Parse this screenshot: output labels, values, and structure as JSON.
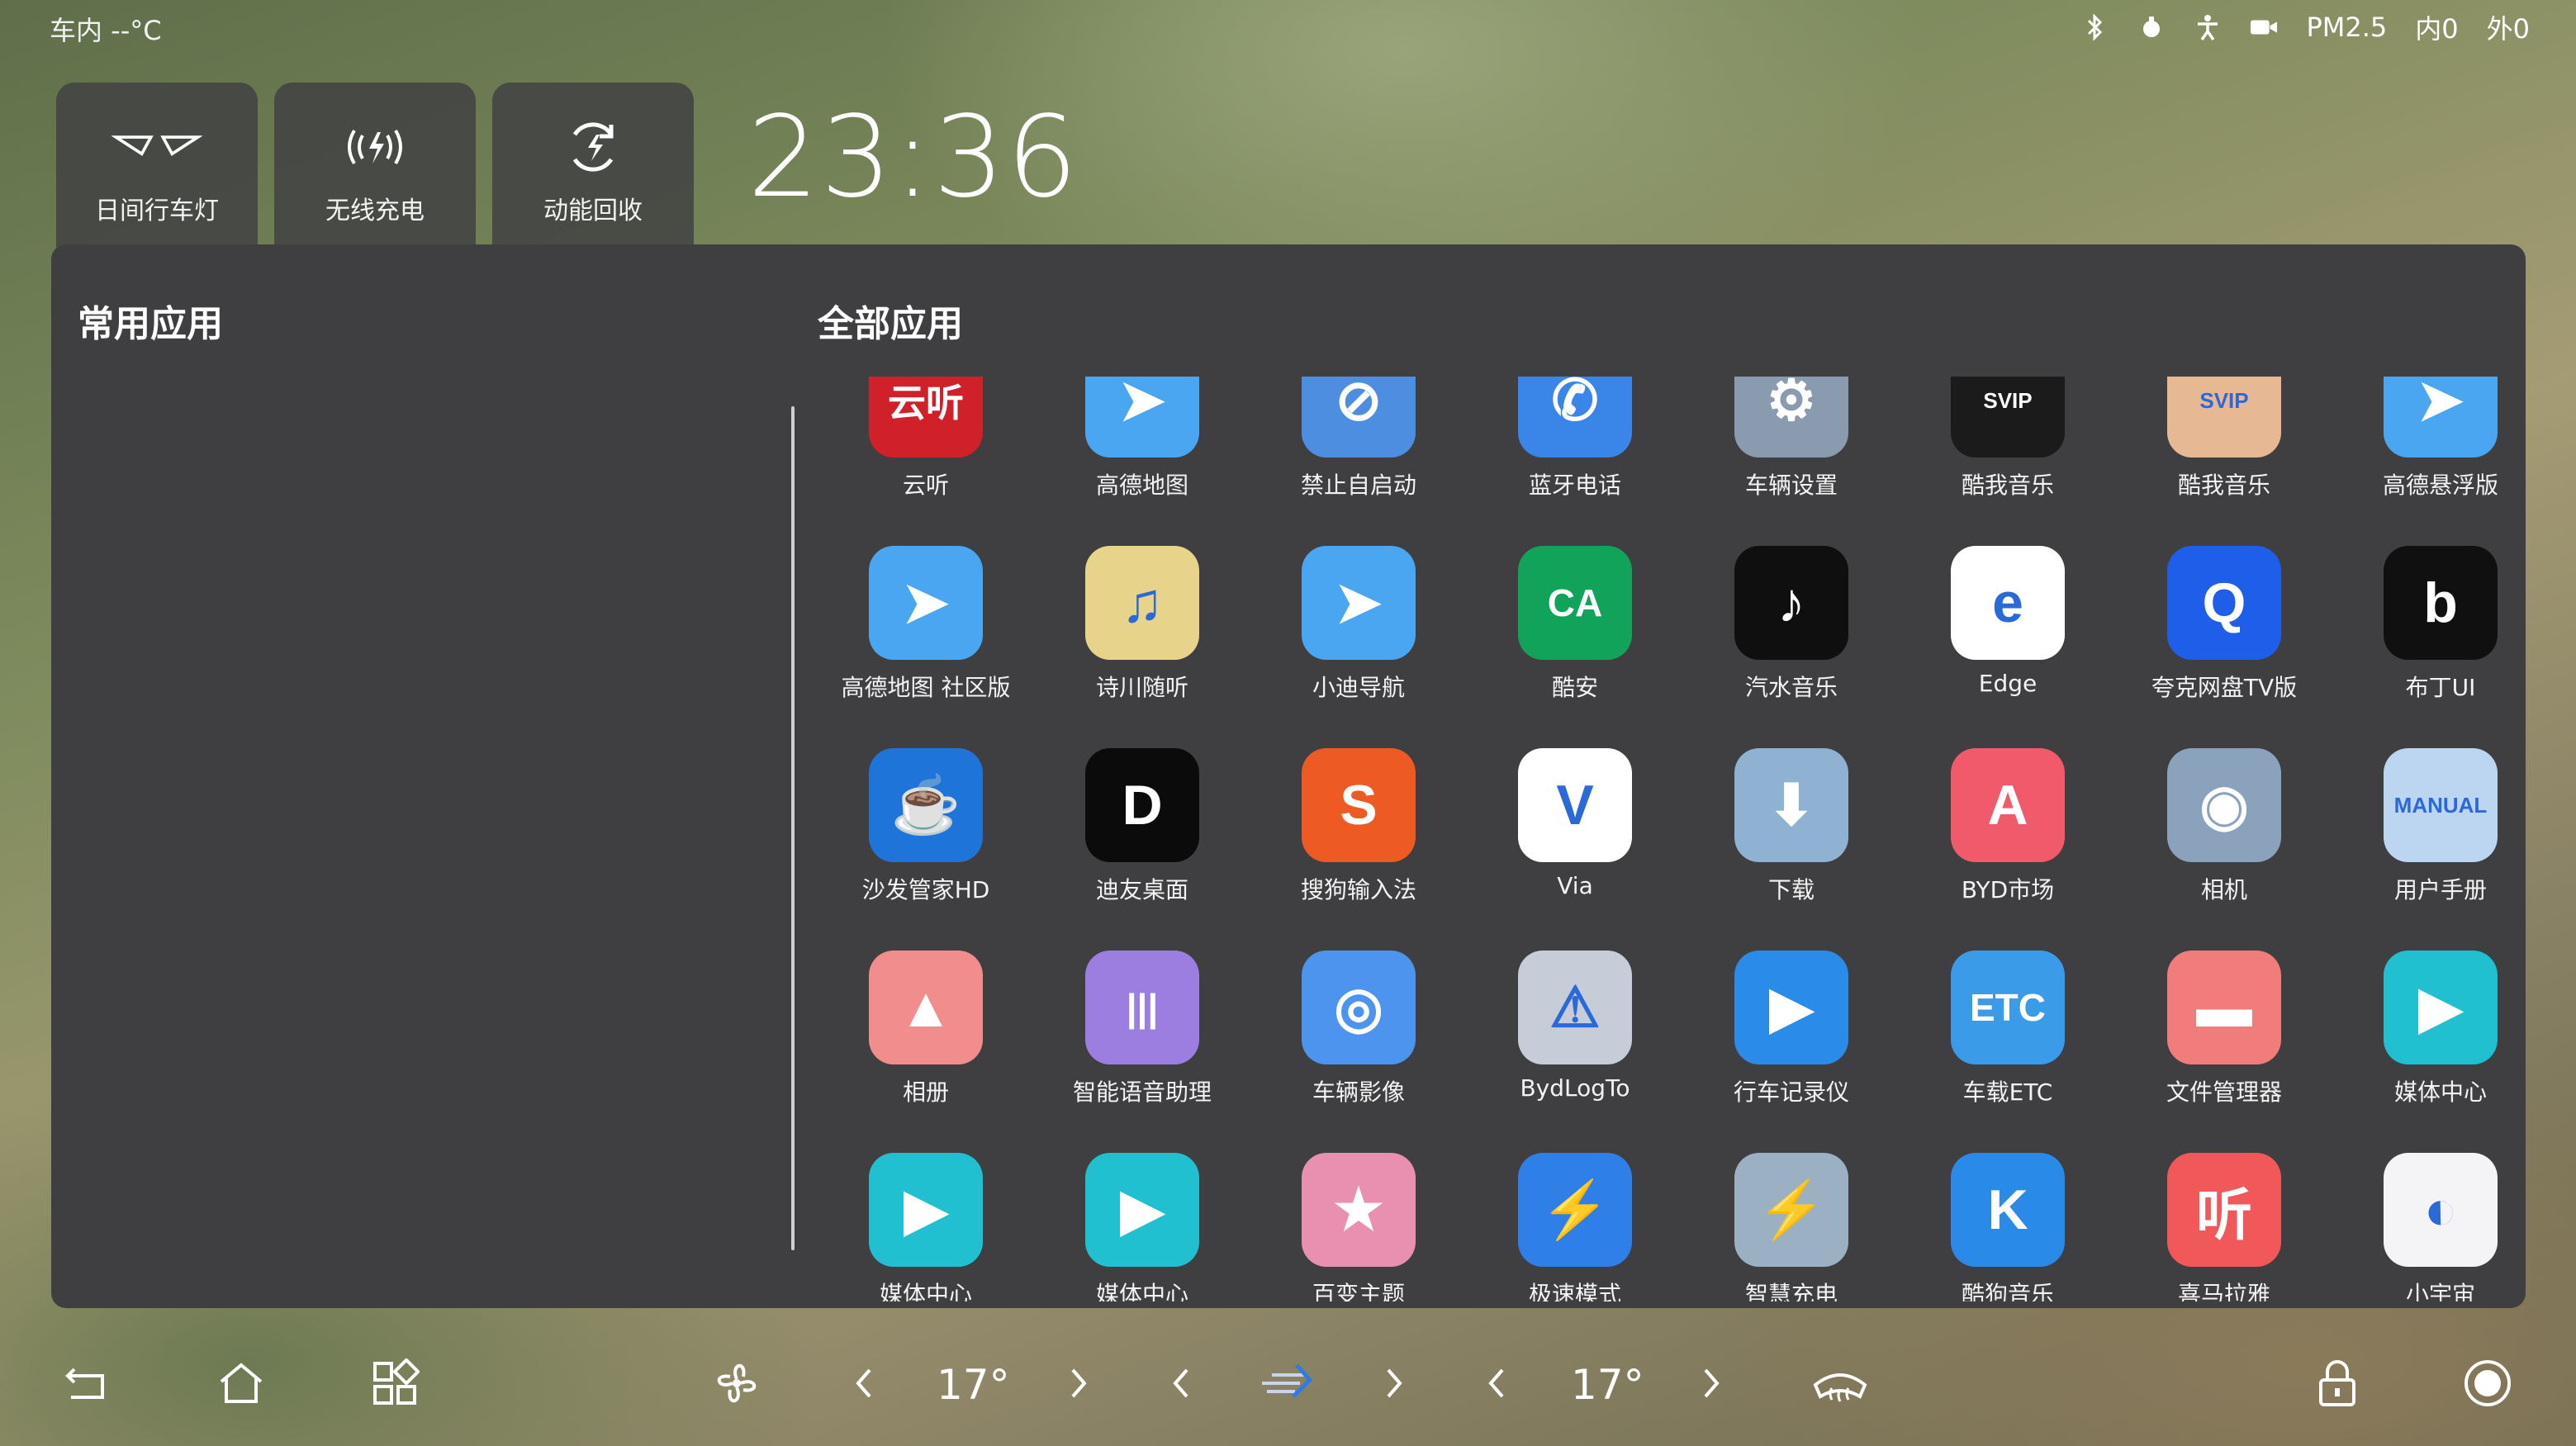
{
  "status": {
    "inside_temp": "车内 --°C",
    "pm25": "PM2.5",
    "pm_in": "内0",
    "pm_out": "外0",
    "icons": [
      "bluetooth-icon",
      "sentry-icon",
      "person-icon",
      "camera-icon"
    ]
  },
  "quick_tiles": [
    {
      "label": "日间行车灯",
      "icon": "daytime-light-icon"
    },
    {
      "label": "无线充电",
      "icon": "wireless-charge-icon"
    },
    {
      "label": "动能回收",
      "icon": "energy-recovery-icon"
    }
  ],
  "clock": "23:36",
  "sections": {
    "frequent": "常用应用",
    "all": "全部应用"
  },
  "apps": [
    {
      "label": "云听",
      "color": "#d0202a",
      "glyph": "云听"
    },
    {
      "label": "高德地图",
      "color": "#4aa6f0",
      "glyph": "➤"
    },
    {
      "label": "禁止自启动",
      "color": "#4d8ee0",
      "glyph": "⊘"
    },
    {
      "label": "蓝牙电话",
      "color": "#3a86e8",
      "glyph": "✆"
    },
    {
      "label": "车辆设置",
      "color": "#8a9bb0",
      "glyph": "⚙"
    },
    {
      "label": "酷我音乐",
      "color": "#1b1b1b",
      "glyph": "SVIP"
    },
    {
      "label": "酷我音乐",
      "color": "#e6b894",
      "glyph": "SVIP"
    },
    {
      "label": "高德悬浮版",
      "color": "#4aa6f0",
      "glyph": "➤"
    },
    {
      "label": "高德地图 社区版",
      "color": "#4aa6f0",
      "glyph": "➤"
    },
    {
      "label": "诗川随听",
      "color": "#e8d38a",
      "glyph": "♫"
    },
    {
      "label": "小迪导航",
      "color": "#4aa6f0",
      "glyph": "➤"
    },
    {
      "label": "酷安",
      "color": "#11a35a",
      "glyph": "CA"
    },
    {
      "label": "汽水音乐",
      "color": "#0f0f0f",
      "glyph": "♪"
    },
    {
      "label": "Edge",
      "color": "#ffffff",
      "glyph": "e"
    },
    {
      "label": "夸克网盘TV版",
      "color": "#1f5ee8",
      "glyph": "Q"
    },
    {
      "label": "布丁UI",
      "color": "#101010",
      "glyph": "b"
    },
    {
      "label": "沙发管家HD",
      "color": "#1e74d8",
      "glyph": "☕"
    },
    {
      "label": "迪友桌面",
      "color": "#0b0b0b",
      "glyph": "D"
    },
    {
      "label": "搜狗输入法",
      "color": "#ee5a24",
      "glyph": "S"
    },
    {
      "label": "Via",
      "color": "#ffffff",
      "glyph": "V"
    },
    {
      "label": "下载",
      "color": "#8fb2d2",
      "glyph": "⬇"
    },
    {
      "label": "BYD市场",
      "color": "#f05a6a",
      "glyph": "A"
    },
    {
      "label": "相机",
      "color": "#8aa2bc",
      "glyph": "◉"
    },
    {
      "label": "用户手册",
      "color": "#bcd6f2",
      "glyph": "MANUAL"
    },
    {
      "label": "相册",
      "color": "#f28d8d",
      "glyph": "▲"
    },
    {
      "label": "智能语音助理",
      "color": "#9b7ee0",
      "glyph": "|||"
    },
    {
      "label": "车辆影像",
      "color": "#4c94ee",
      "glyph": "◎"
    },
    {
      "label": "BydLogTo",
      "color": "#c6ccd8",
      "glyph": "⚠"
    },
    {
      "label": "行车记录仪",
      "color": "#2a8ce8",
      "glyph": "▶"
    },
    {
      "label": "车载ETC",
      "color": "#3a9be8",
      "glyph": "ETC"
    },
    {
      "label": "文件管理器",
      "color": "#f07c7c",
      "glyph": "▬"
    },
    {
      "label": "媒体中心",
      "color": "#21c0d0",
      "glyph": "▶"
    },
    {
      "label": "媒体中心",
      "color": "#21c0d0",
      "glyph": "▶"
    },
    {
      "label": "媒体中心",
      "color": "#21c0d0",
      "glyph": "▶"
    },
    {
      "label": "百变主题",
      "color": "#e98fb0",
      "glyph": "★"
    },
    {
      "label": "极速模式",
      "color": "#2e7fe8",
      "glyph": "⚡"
    },
    {
      "label": "智慧充电",
      "color": "#9cb0c4",
      "glyph": "⚡"
    },
    {
      "label": "酷狗音乐",
      "color": "#2a8ae8",
      "glyph": "K"
    },
    {
      "label": "喜马拉雅",
      "color": "#f0585a",
      "glyph": "听"
    },
    {
      "label": "小宇宙",
      "color": "#f4f4f6",
      "glyph": "◐"
    }
  ],
  "bottom": {
    "temp_left": "17°",
    "temp_right": "17°"
  }
}
